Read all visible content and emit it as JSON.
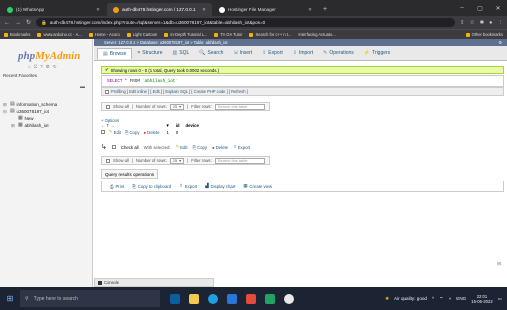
{
  "browser": {
    "tabs": [
      {
        "title": "(1) WhatsApp",
        "active": false,
        "icon_color": "#25d366"
      },
      {
        "title": "auth-db478.hstinger.com / 127.0.0.1",
        "active": true,
        "icon_color": "#f89c0e"
      },
      {
        "title": "Hostinger File Manager",
        "active": false,
        "icon_color": "#ffffff"
      }
    ],
    "new_tab": "+",
    "url": "auth-db478.hstinger.com/index.php?route=/sql&server=1&db=u360078197_iot&table=abhilash_iot&pos=0",
    "bookmarks": [
      "Bookmarks",
      "www.arduino.cc - A...",
      "Home - Acoro",
      "Light Cartoon",
      "In-Depth Tutorial L...",
      "TA OA Tutor",
      "Search for c++ n t...",
      "Interfacing Actuato...",
      "Other bookmarks"
    ]
  },
  "pma": {
    "logo_php": "php",
    "logo_admin": "MyAdmin",
    "recent": "Recent  Favorites",
    "tree": [
      {
        "sign": "⊞",
        "label": "information_schema"
      },
      {
        "sign": "⊟",
        "label": "u360078197_iot"
      },
      {
        "sign": "",
        "label": "New"
      },
      {
        "sign": "⊞",
        "label": "abhilash_iot"
      }
    ],
    "breadcrumb": "Server: 127.0.0.1 » Database: u360078197_iot » Table: abhilash_iot",
    "tabs": [
      {
        "icon": "▤",
        "label": "Browse"
      },
      {
        "icon": "⌗",
        "label": "Structure"
      },
      {
        "icon": "▥",
        "label": "SQL"
      },
      {
        "icon": "🔍",
        "label": "Search"
      },
      {
        "icon": "⇲",
        "label": "Insert"
      },
      {
        "icon": "⇪",
        "label": "Export"
      },
      {
        "icon": "⇩",
        "label": "Import"
      },
      {
        "icon": "✎",
        "label": "Operations"
      },
      {
        "icon": "⚡",
        "label": "Triggers"
      }
    ],
    "success_msg": "Showing rows 0 - 0 (1 total, Query took 0.0002 seconds.)",
    "sql_select": "SELECT",
    "sql_rest": "* FROM",
    "sql_table": "`abhilash_iot`",
    "profiling": "Profiling [ Edit inline ] [ Edit ] [ Explain SQL ] [ Create PHP code ] [ Refresh ]",
    "nav": {
      "show_all": "Show all",
      "rows_label": "Number of rows:",
      "rows_value": "25",
      "filter_label": "Filter rows:",
      "filter_placeholder": "Search this table"
    },
    "options": "+ Options",
    "col_arrows": "← T →",
    "col_header_sort": "▼",
    "col_header_id": "id",
    "col_header_device": "device",
    "row": {
      "edit": "Edit",
      "copy": "Copy",
      "delete": "Delete",
      "id": "1",
      "device": "0"
    },
    "with_selected": {
      "check_all": "Check all",
      "with_selected": "With selected:",
      "edit": "Edit",
      "copy": "Copy",
      "delete": "Delete",
      "export": "Export"
    },
    "query_ops": "Query results operations",
    "qr_actions": [
      "Print",
      "Copy to clipboard",
      "Export",
      "Display chart",
      "Create view"
    ],
    "console": "Console"
  },
  "taskbar": {
    "search_placeholder": "Type here to search",
    "air_quality": "Air quality: good",
    "lang": "ENG",
    "time": "22:01",
    "date": "15-06-2022"
  }
}
